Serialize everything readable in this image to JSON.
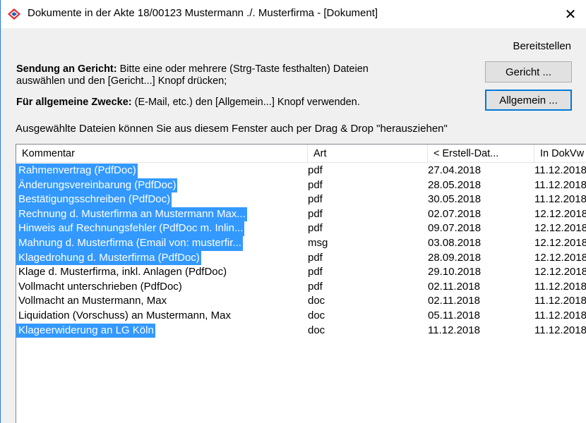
{
  "window": {
    "title": "Dokumente in der Akte 18/00123 Mustermann ./. Musterfirma - [Dokument]",
    "close_glyph": "✕"
  },
  "bereitstellen": {
    "label": "Bereitstellen",
    "gericht_button": "Gericht ...",
    "allgemein_button": "Allgemein ..."
  },
  "info": {
    "gericht_bold": "Sendung an Gericht:",
    "gericht_text": " Bitte eine oder mehrere (Strg-Taste festhalten) Dateien",
    "gericht_text2": "auswählen und den [Gericht...] Knopf drücken;",
    "allgemein_bold": "Für allgemeine Zwecke:",
    "allgemein_text": " (E-Mail, etc.) den [Allgemein...] Knopf verwenden."
  },
  "hint": "Ausgewählte Dateien können Sie aus diesem Fenster auch per Drag & Drop \"herausziehen\"",
  "table": {
    "columns": [
      "Kommentar",
      "Art",
      "< Erstell-Dat...",
      "In DokVw"
    ],
    "rows": [
      {
        "kommentar": "Rahmenvertrag (PdfDoc)",
        "art": "pdf",
        "erstell": "27.04.2018",
        "dokvw": "11.12.2018",
        "selected": true
      },
      {
        "kommentar": "Änderungsvereinbarung (PdfDoc)",
        "art": "pdf",
        "erstell": "28.05.2018",
        "dokvw": "11.12.2018",
        "selected": true
      },
      {
        "kommentar": "Bestätigungsschreiben (PdfDoc)",
        "art": "pdf",
        "erstell": "30.05.2018",
        "dokvw": "11.12.2018",
        "selected": true
      },
      {
        "kommentar": "Rechnung d. Musterfirma an Mustermann Max...",
        "art": "pdf",
        "erstell": "02.07.2018",
        "dokvw": "12.12.2018",
        "selected": true
      },
      {
        "kommentar": "Hinweis auf Rechnungsfehler (PdfDoc m. Inlin...",
        "art": "pdf",
        "erstell": "09.07.2018",
        "dokvw": "12.12.2018",
        "selected": true
      },
      {
        "kommentar": "Mahnung d. Musterfirma (Email von: musterfir...",
        "art": "msg",
        "erstell": "03.08.2018",
        "dokvw": "12.12.2018",
        "selected": true
      },
      {
        "kommentar": "Klagedrohung d. Musterfirma (PdfDoc)",
        "art": "pdf",
        "erstell": "28.09.2018",
        "dokvw": "12.12.2018",
        "selected": true
      },
      {
        "kommentar": "Klage d. Musterfirma, inkl. Anlagen (PdfDoc)",
        "art": "pdf",
        "erstell": "29.10.2018",
        "dokvw": "12.12.2018",
        "selected": false
      },
      {
        "kommentar": "Vollmacht unterschrieben (PdfDoc)",
        "art": "pdf",
        "erstell": "02.11.2018",
        "dokvw": "11.12.2018",
        "selected": false
      },
      {
        "kommentar": "Vollmacht  an Mustermann, Max",
        "art": "doc",
        "erstell": "02.11.2018",
        "dokvw": "11.12.2018",
        "selected": false
      },
      {
        "kommentar": "Liquidation (Vorschuss)  an Mustermann, Max",
        "art": "doc",
        "erstell": "05.11.2018",
        "dokvw": "11.12.2018",
        "selected": false
      },
      {
        "kommentar": "Klageerwiderung  an LG Köln",
        "art": "doc",
        "erstell": "11.12.2018",
        "dokvw": "11.12.2018",
        "selected": true
      }
    ]
  },
  "colors": {
    "selection": "#3399ff",
    "window_border": "#2b79d8",
    "app_icon_red": "#e3262b",
    "app_icon_blue": "#1f5fbf"
  }
}
